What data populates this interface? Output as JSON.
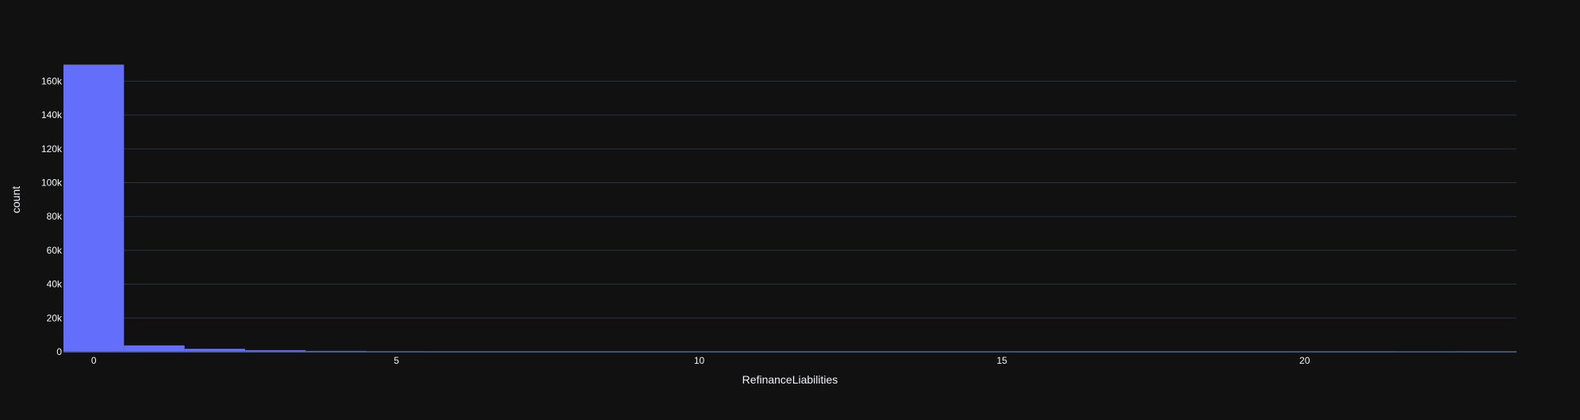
{
  "chart_data": {
    "type": "bar",
    "subtype": "histogram",
    "xlabel": "RefinanceLiabilities",
    "ylabel": "count",
    "xlim": [
      -0.5,
      23.5
    ],
    "ylim": [
      0,
      178000
    ],
    "x_ticks": [
      0,
      5,
      10,
      15,
      20
    ],
    "x_tick_labels": [
      "0",
      "5",
      "10",
      "15",
      "20"
    ],
    "y_ticks": [
      0,
      20000,
      40000,
      60000,
      80000,
      100000,
      120000,
      140000,
      160000
    ],
    "y_tick_labels": [
      "0",
      "20k",
      "40k",
      "60k",
      "80k",
      "100k",
      "120k",
      "140k",
      "160k"
    ],
    "bin_width": 1,
    "bins": [
      {
        "x": 0,
        "count": 169800
      },
      {
        "x": 1,
        "count": 3800
      },
      {
        "x": 2,
        "count": 1800
      },
      {
        "x": 3,
        "count": 1000
      },
      {
        "x": 4,
        "count": 550
      },
      {
        "x": 5,
        "count": 300
      },
      {
        "x": 6,
        "count": 180
      },
      {
        "x": 7,
        "count": 110
      },
      {
        "x": 8,
        "count": 60
      },
      {
        "x": 9,
        "count": 40
      },
      {
        "x": 10,
        "count": 25
      },
      {
        "x": 11,
        "count": 15
      },
      {
        "x": 12,
        "count": 10
      },
      {
        "x": 13,
        "count": 6
      },
      {
        "x": 14,
        "count": 4
      },
      {
        "x": 15,
        "count": 3
      },
      {
        "x": 16,
        "count": 2
      },
      {
        "x": 17,
        "count": 2
      },
      {
        "x": 18,
        "count": 1
      },
      {
        "x": 19,
        "count": 1
      },
      {
        "x": 20,
        "count": 1
      },
      {
        "x": 21,
        "count": 1
      },
      {
        "x": 23,
        "count": 1
      }
    ],
    "grid": true,
    "legend": false,
    "colors": {
      "background": "#111111",
      "bar": "#636efa",
      "grid": "#283442",
      "axis_line": "#506784",
      "text": "#f2f5fa"
    }
  }
}
